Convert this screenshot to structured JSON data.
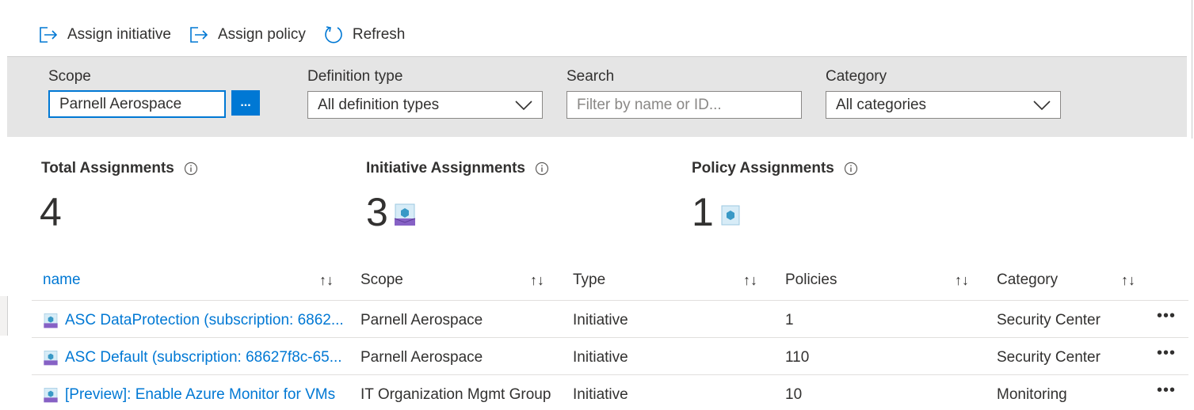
{
  "toolbar": {
    "assign_initiative": "Assign initiative",
    "assign_policy": "Assign policy",
    "refresh": "Refresh"
  },
  "filters": {
    "scope_label": "Scope",
    "scope_value": "Parnell Aerospace",
    "scope_button": "...",
    "definition_type_label": "Definition type",
    "definition_type_value": "All definition types",
    "search_label": "Search",
    "search_placeholder": "Filter by name or ID...",
    "category_label": "Category",
    "category_value": "All categories"
  },
  "stats": {
    "total_label": "Total Assignments",
    "total_value": "4",
    "initiative_label": "Initiative Assignments",
    "initiative_value": "3",
    "policy_label": "Policy Assignments",
    "policy_value": "1"
  },
  "table": {
    "columns": [
      "name",
      "Scope",
      "Type",
      "Policies",
      "Category"
    ],
    "rows": [
      {
        "name": "ASC DataProtection (subscription: 6862...",
        "scope": "Parnell Aerospace",
        "type": "Initiative",
        "policies": "1",
        "category": "Security Center"
      },
      {
        "name": "ASC Default (subscription: 68627f8c-65...",
        "scope": "Parnell Aerospace",
        "type": "Initiative",
        "policies": "110",
        "category": "Security Center"
      },
      {
        "name": "[Preview]: Enable Azure Monitor for VMs",
        "scope": "IT Organization Mgmt Group",
        "type": "Initiative",
        "policies": "10",
        "category": "Monitoring"
      }
    ],
    "more_label": "•••",
    "sort_glyph": "↑↓"
  },
  "colors": {
    "accent": "#0078d4",
    "initiative_icon": "#8661c5",
    "policy_icon": "#3999c6"
  },
  "icons": {
    "assign": "assign-arrow-icon",
    "refresh": "refresh-icon",
    "info": "info-icon",
    "initiative": "initiative-icon",
    "policy": "policy-icon",
    "chevron": "chevron-down-icon"
  }
}
